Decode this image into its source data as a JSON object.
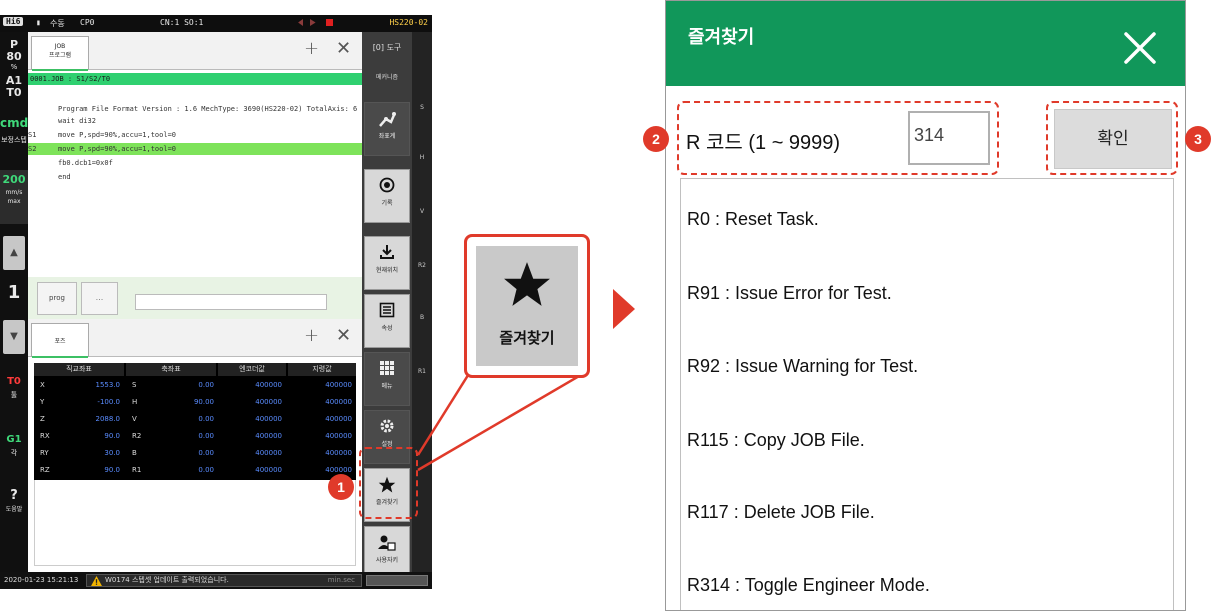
{
  "tablet": {
    "app_badge": "Hi6",
    "top_items": [
      "수동",
      "CP0"
    ],
    "connection": "CN:1 SO:1",
    "model": "HS220-02",
    "left_status": {
      "p_label": "P",
      "p_value": "80",
      "p_unit": "%",
      "a_label": "A1",
      "t_label": "T0",
      "cmd": "cmd",
      "cmd_sub": "보정스텝",
      "speed": "200",
      "speed_unit": "mm/s",
      "speed_mode": "max",
      "step_value": "1",
      "t0": "T0",
      "t0_sub": "툴",
      "g1": "G1",
      "g1_sub": "각",
      "help": "도움말"
    },
    "job": {
      "tab_label": "JOB\n프로그램",
      "header": "0001.JOB : S1/S2/T0",
      "lines": [
        {
          "num": "",
          "code": "Program File Format Version : 1.6  MechType: 3690(HS220-02)  TotalAxis: 6"
        },
        {
          "num": "",
          "code": "wait di32"
        },
        {
          "num": "S1",
          "code": "move P,spd=90%,accu=1,tool=0"
        },
        {
          "num": "S2",
          "code": "move P,spd=90%,accu=1,tool=0"
        },
        {
          "num": "",
          "code": "fb0.dcb1=0x0f"
        },
        {
          "num": "",
          "code": "end"
        }
      ]
    },
    "cmd": {
      "prog_label": "prog",
      "dots_label": "..."
    },
    "pose": {
      "tab_label": "포즈",
      "headers": [
        "직교좌표",
        "축좌표",
        "엔코더값",
        "지령값"
      ],
      "rows": [
        {
          "k1": "X",
          "v1": "1553.0",
          "k2": "S",
          "v2": "0.00",
          "e": "400000",
          "c": "400000"
        },
        {
          "k1": "Y",
          "v1": "-100.0",
          "k2": "H",
          "v2": "90.00",
          "e": "400000",
          "c": "400000"
        },
        {
          "k1": "Z",
          "v1": "2088.0",
          "k2": "V",
          "v2": "0.00",
          "e": "400000",
          "c": "400000"
        },
        {
          "k1": "RX",
          "v1": "90.0",
          "k2": "R2",
          "v2": "0.00",
          "e": "400000",
          "c": "400000"
        },
        {
          "k1": "RY",
          "v1": "30.0",
          "k2": "B",
          "v2": "0.00",
          "e": "400000",
          "c": "400000"
        },
        {
          "k1": "RZ",
          "v1": "90.0",
          "k2": "R1",
          "v2": "0.00",
          "e": "400000",
          "c": "400000"
        }
      ]
    },
    "right_menu": {
      "title": "[0] 도구",
      "subtitle": "메커니즘",
      "buttons": [
        {
          "label": "좌표계",
          "icon": "robot-arm-icon"
        },
        {
          "label": "기록",
          "icon": "record-icon"
        },
        {
          "label": "현재위치",
          "icon": "download-icon"
        },
        {
          "label": "속성",
          "icon": "list-icon"
        },
        {
          "label": "메뉴",
          "icon": "grid-icon"
        },
        {
          "label": "설정",
          "icon": "gear-icon"
        },
        {
          "label": "즐겨찾기",
          "icon": "star-icon"
        },
        {
          "label": "사용자키",
          "icon": "user-key-icon"
        }
      ],
      "axis_labels": [
        "S",
        "H",
        "V",
        "R2",
        "B",
        "R1"
      ]
    },
    "bottom": {
      "datetime": "2020-01-23 15:21:13",
      "warning": "W0174 스텝셋 업데이트 출력되었습니다.",
      "right": "min.sec"
    }
  },
  "callouts": {
    "one": "1",
    "two": "2",
    "three": "3"
  },
  "star_zoom": {
    "label": "즐겨찾기",
    "icon": "star-icon"
  },
  "dialog": {
    "title": "즐겨찾기",
    "rcode_label": "R 코드 (1 ~ 9999)",
    "rcode_value": "314",
    "confirm_label": "확인",
    "items": [
      "R0 : Reset Task.",
      "R91 : Issue Error for Test.",
      "R92 : Issue Warning for Test.",
      "R115 : Copy JOB File.",
      "R117 : Delete JOB File.",
      "R314 : Toggle Engineer Mode."
    ]
  },
  "colors": {
    "accent_green": "#11975a",
    "callout_red": "#e03a2a",
    "highlight_green": "#7ee35a"
  }
}
